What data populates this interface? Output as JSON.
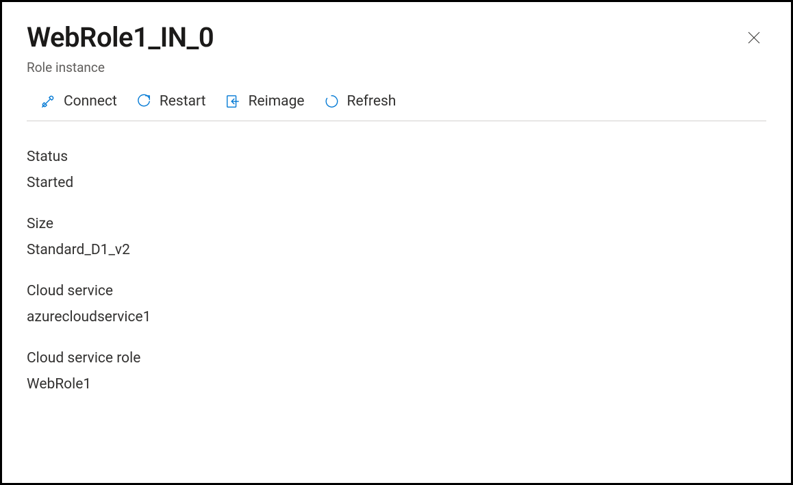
{
  "header": {
    "title": "WebRole1_IN_0",
    "subtitle": "Role instance"
  },
  "toolbar": {
    "connect_label": "Connect",
    "restart_label": "Restart",
    "reimage_label": "Reimage",
    "refresh_label": "Refresh"
  },
  "properties": {
    "status": {
      "label": "Status",
      "value": "Started"
    },
    "size": {
      "label": "Size",
      "value": "Standard_D1_v2"
    },
    "cloud_service": {
      "label": "Cloud service",
      "value": "azurecloudservice1"
    },
    "cloud_service_role": {
      "label": "Cloud service role",
      "value": "WebRole1"
    }
  },
  "colors": {
    "accent": "#0078d4"
  }
}
